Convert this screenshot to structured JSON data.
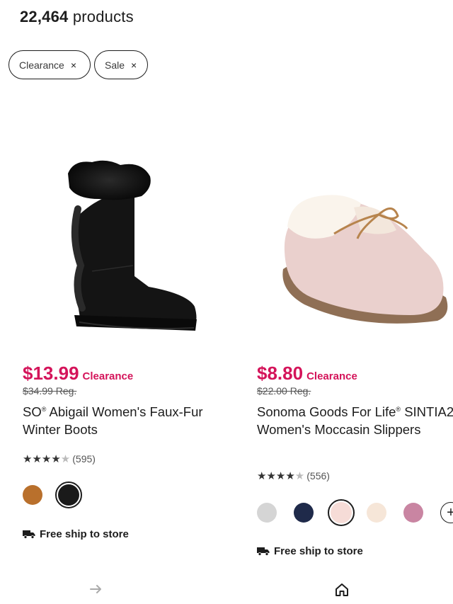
{
  "header": {
    "count_value": "22,464",
    "count_label": "products"
  },
  "filters": [
    {
      "label": "Clearance",
      "remove_icon": "close-icon",
      "remove_glyph": "×"
    },
    {
      "label": "Sale",
      "remove_icon": "close-icon",
      "remove_glyph": "×"
    }
  ],
  "products": [
    {
      "price": "$13.99",
      "price_tag": "Clearance",
      "regular_price": "$34.99 Reg.",
      "title_brand": "SO",
      "title_mark": "®",
      "title_rest": " Abigail Women's Faux-Fur Winter Boots",
      "stars_full": "★★★★",
      "stars_half": "★",
      "rating_value": 4.5,
      "review_count": "(595)",
      "swatch_colors": [
        "#b9702c",
        "#1a1a1a"
      ],
      "selected_swatch": 1,
      "shipping": "Free ship to store"
    },
    {
      "price": "$8.80",
      "price_tag": "Clearance",
      "regular_price": "$22.00 Reg.",
      "title_brand": "Sonoma Goods For Life",
      "title_mark": "®",
      "title_rest": " SINTIA2 Women's Moccasin Slippers",
      "stars_full": "★★★★",
      "stars_half": "★",
      "rating_value": 4.5,
      "review_count": "(556)",
      "swatch_colors": [
        "#d5d5d5",
        "#1f2a4a",
        "#f6dcd7",
        "#f6e6d8",
        "#c985a2"
      ],
      "selected_swatch": 2,
      "more_swatches_icon": "plus-icon",
      "shipping": "Free ship to store"
    }
  ],
  "bottom_nav": {
    "left_icon": "arrow-right-icon",
    "right_icon": "home-icon"
  },
  "colors": {
    "sale_red": "#d4145a",
    "ink": "#1d1d1d"
  }
}
